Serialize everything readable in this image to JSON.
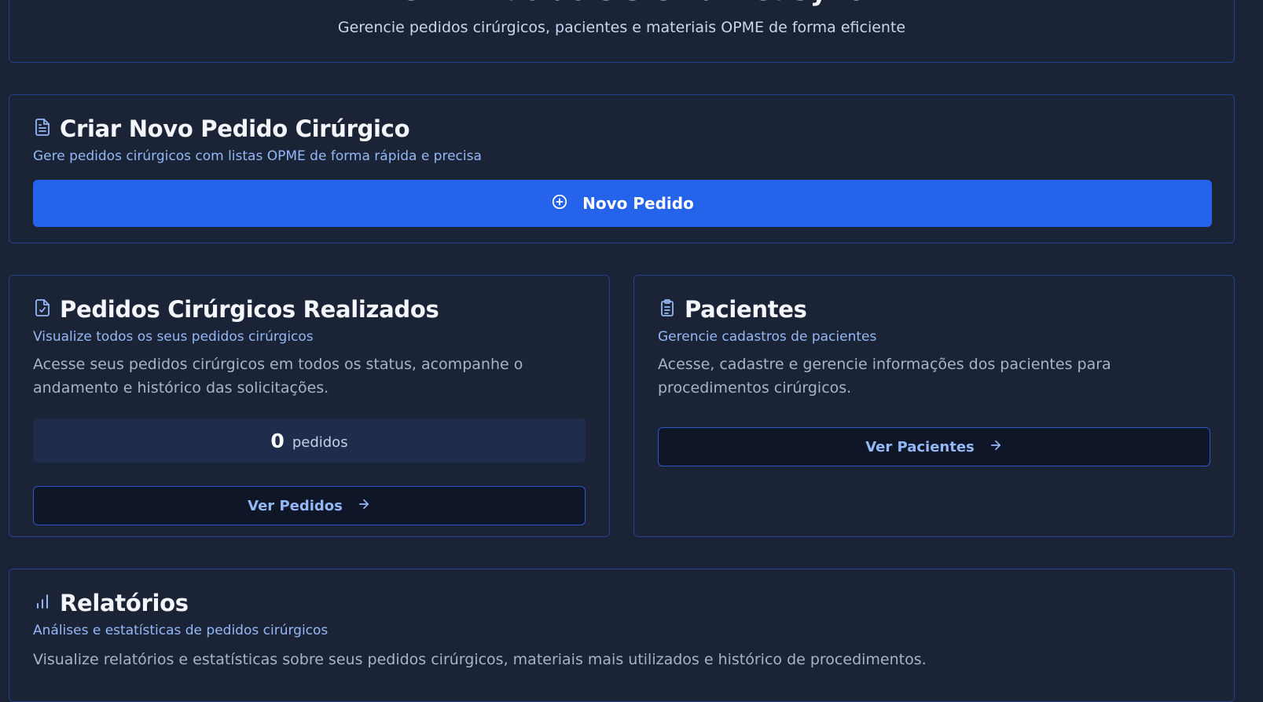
{
  "hero": {
    "title": "Bem-vindo ao Sistema MedSync",
    "subtitle": "Gerencie pedidos cirúrgicos, pacientes e materiais OPME de forma eficiente"
  },
  "novo_pedido": {
    "icon": "file-text-icon",
    "title": "Criar Novo Pedido Cirúrgico",
    "subtitle": "Gere pedidos cirúrgicos com listas OPME de forma rápida e precisa",
    "button_icon": "plus-circle-icon",
    "button_label": "Novo Pedido"
  },
  "pedidos": {
    "icon": "file-check-icon",
    "title": "Pedidos Cirúrgicos Realizados",
    "subtitle": "Visualize todos os seus pedidos cirúrgicos",
    "description": "Acesse seus pedidos cirúrgicos em todos os status, acompanhe o andamento e histórico das solicitações.",
    "count": "0",
    "count_label": "pedidos",
    "button_label": "Ver Pedidos",
    "button_icon": "arrow-right-icon"
  },
  "pacientes": {
    "icon": "clipboard-list-icon",
    "title": "Pacientes",
    "subtitle": "Gerencie cadastros de pacientes",
    "description": "Acesse, cadastre e gerencie informações dos pacientes para procedimentos cirúrgicos.",
    "button_label": "Ver Pacientes",
    "button_icon": "arrow-right-icon"
  },
  "relatorios": {
    "icon": "bar-chart-icon",
    "title": "Relatórios",
    "subtitle": "Análises e estatísticas de pedidos cirúrgicos",
    "description": "Visualize relatórios e estatísticas sobre seus pedidos cirúrgicos, materiais mais utilizados e histórico de procedimentos."
  },
  "colors": {
    "background": "#1a2335",
    "card_border": "#26418a",
    "primary": "#2563eb",
    "accent_text": "#93b8f5"
  }
}
